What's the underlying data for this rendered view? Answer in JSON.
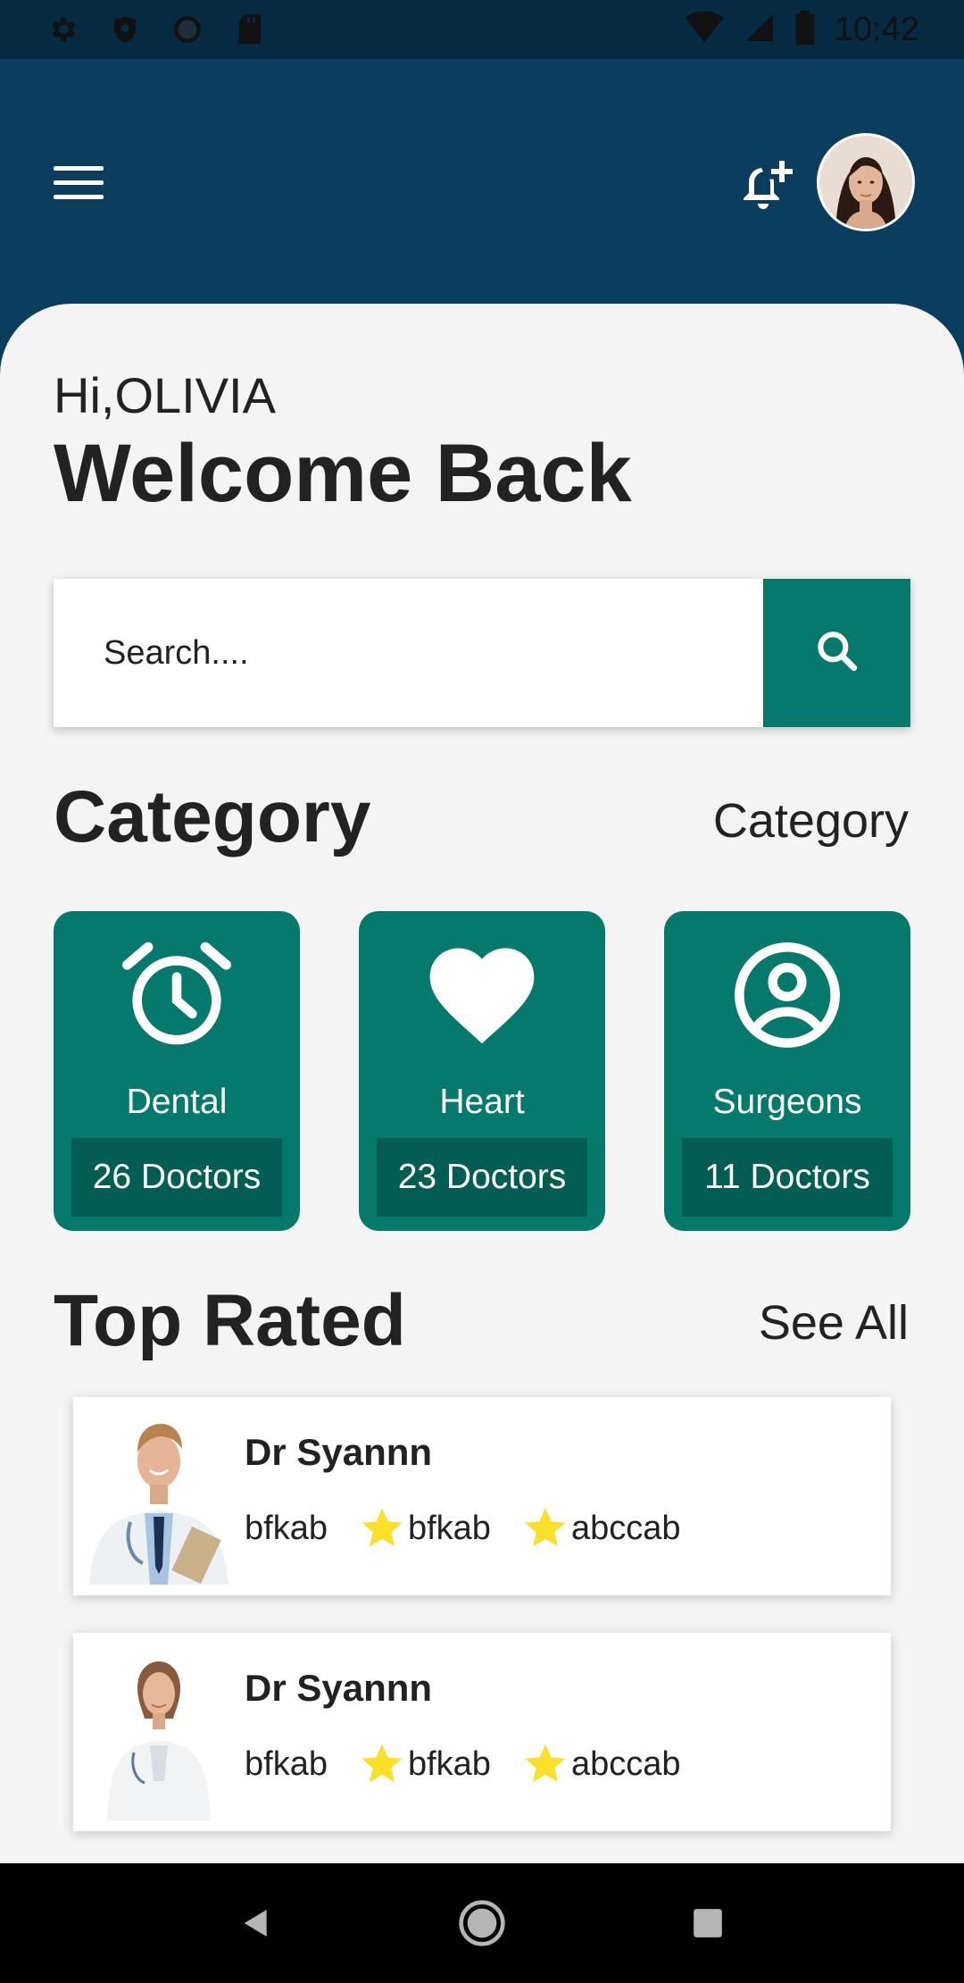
{
  "status_bar": {
    "time": "10:42",
    "left_icons": [
      "settings-icon",
      "shield-icon",
      "circle-icon",
      "sd-card-icon"
    ],
    "right_icons": [
      "wifi-icon",
      "signal-icon",
      "battery-icon"
    ]
  },
  "header": {
    "menu_icon": "menu-icon",
    "notification_icon": "bell-plus-icon",
    "avatar": "user-avatar"
  },
  "greeting": {
    "hi": "Hi,OLIVIA",
    "welcome": "Welcome Back"
  },
  "search": {
    "placeholder": "Search....",
    "button_icon": "search-icon"
  },
  "category_section": {
    "title": "Category",
    "link": "Category",
    "items": [
      {
        "icon": "alarm-clock-icon",
        "name": "Dental",
        "count": "26 Doctors"
      },
      {
        "icon": "heart-icon",
        "name": "Heart",
        "count": "23 Doctors"
      },
      {
        "icon": "account-circle-icon",
        "name": "Surgeons",
        "count": "11 Doctors"
      }
    ]
  },
  "top_rated": {
    "title": "Top Rated",
    "link": "See All",
    "doctors": [
      {
        "name": "Dr Syannn",
        "field1": "bfkab",
        "field2": "bfkab",
        "field3": "abccab"
      },
      {
        "name": "Dr Syannn",
        "field1": "bfkab",
        "field2": "bfkab",
        "field3": "abccab"
      }
    ]
  },
  "colors": {
    "header": "#0a3d5e",
    "accent": "#05796b",
    "accent_dark": "#035d53",
    "star": "#fbe02a",
    "background": "#f4f4f4"
  }
}
